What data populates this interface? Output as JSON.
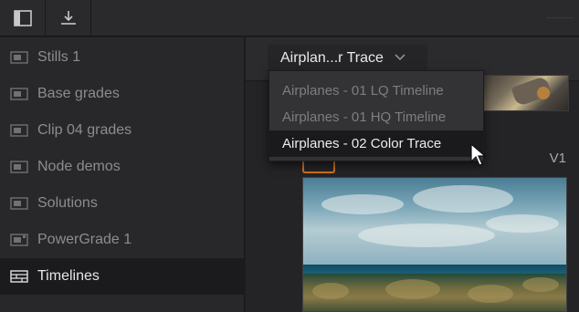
{
  "toolbar": {
    "buttons": [
      {
        "icon": "sidebar-toggle-icon"
      },
      {
        "icon": "import-download-icon"
      }
    ]
  },
  "sidebar": {
    "items": [
      {
        "label": "Stills 1",
        "icon": "still-album-icon",
        "active": false
      },
      {
        "label": "Base grades",
        "icon": "still-album-icon",
        "active": false
      },
      {
        "label": "Clip 04 grades",
        "icon": "still-album-icon",
        "active": false
      },
      {
        "label": "Node demos",
        "icon": "still-album-icon",
        "active": false
      },
      {
        "label": "Solutions",
        "icon": "still-album-icon",
        "active": false
      },
      {
        "label": "PowerGrade 1",
        "icon": "powergrade-album-icon",
        "active": false
      },
      {
        "label": "Timelines",
        "icon": "timeline-album-icon",
        "active": true
      }
    ]
  },
  "main": {
    "album_select": {
      "value": "Airplan...r Trace"
    },
    "clip": {
      "track": "V1"
    }
  },
  "dropdown": {
    "options": [
      {
        "label": "Airplanes - 01 LQ Timeline",
        "selected": false
      },
      {
        "label": "Airplanes - 01 HQ Timeline",
        "selected": false
      },
      {
        "label": "Airplanes - 02 Color Trace",
        "selected": true
      }
    ]
  },
  "colors": {
    "accent_orange": "#d0701c",
    "sidebar_bg": "#28282b",
    "active_bg": "#1b1b1d"
  }
}
